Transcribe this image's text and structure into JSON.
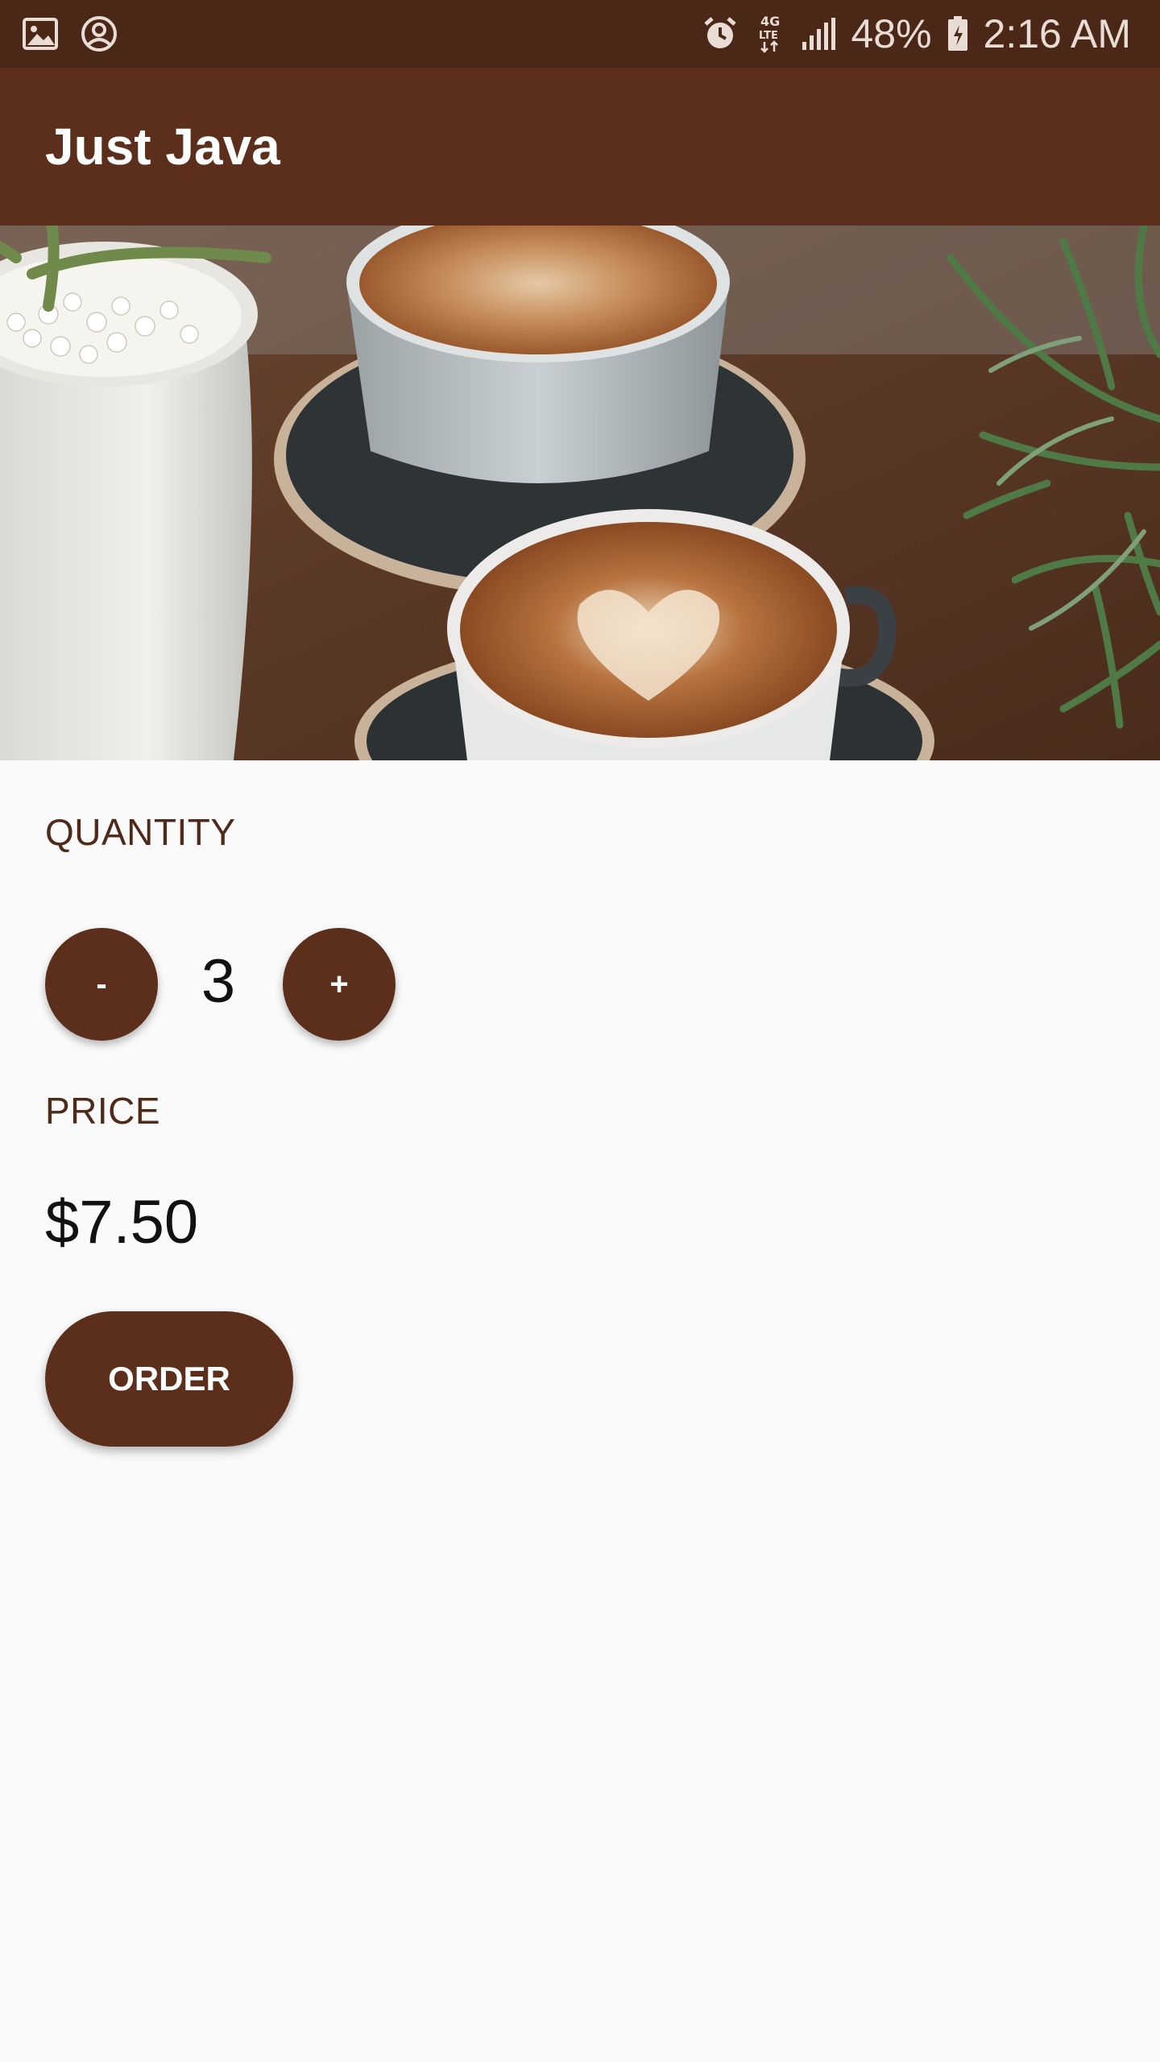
{
  "status_bar": {
    "left_icons": [
      "gallery-icon",
      "account-circle-icon"
    ],
    "right_icons": [
      "alarm-icon",
      "4g-lte-icon",
      "signal-icon",
      "battery-icon"
    ],
    "battery": "48%",
    "time": "2:16 AM"
  },
  "app_bar": {
    "title": "Just Java"
  },
  "hero": {
    "icon": "coffee-cups-image"
  },
  "quantity": {
    "label": "QUANTITY",
    "decrement_label": "-",
    "value": "3",
    "increment_label": "+"
  },
  "price": {
    "label": "PRICE",
    "value": "$7.50"
  },
  "order": {
    "button_label": "ORDER"
  },
  "colors": {
    "primary": "#5b2f1b",
    "status_bar": "#4a2717",
    "background": "#fafafa",
    "label_text": "#4e2a1a"
  }
}
